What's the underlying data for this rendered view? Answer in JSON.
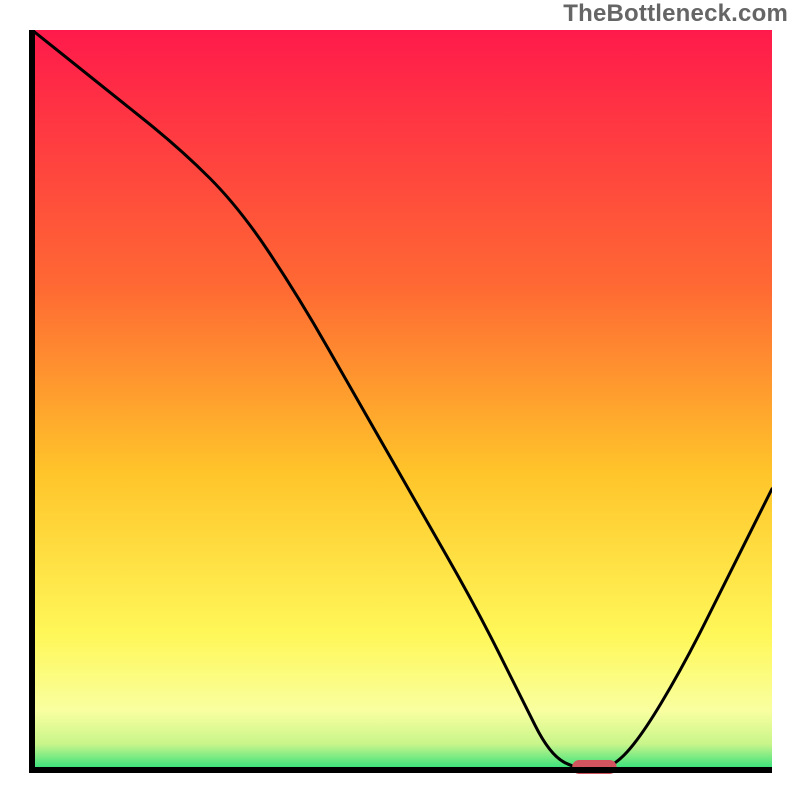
{
  "watermark": {
    "text": "TheBottleneck.com"
  },
  "colors": {
    "frame": "#000000",
    "curve": "#000000",
    "marker_fill": "#d2545f",
    "gradient_stops": [
      {
        "offset": 0.0,
        "color": "#ff1a4b"
      },
      {
        "offset": 0.35,
        "color": "#ff6a33"
      },
      {
        "offset": 0.6,
        "color": "#ffc52a"
      },
      {
        "offset": 0.82,
        "color": "#fff85a"
      },
      {
        "offset": 0.92,
        "color": "#f9ffa0"
      },
      {
        "offset": 0.965,
        "color": "#c8f58b"
      },
      {
        "offset": 1.0,
        "color": "#2de07a"
      }
    ]
  },
  "chart_data": {
    "type": "line",
    "title": "",
    "xlabel": "",
    "ylabel": "",
    "xlim": [
      0,
      100
    ],
    "ylim": [
      0,
      100
    ],
    "series": [
      {
        "name": "bottleneck-curve",
        "x": [
          0,
          10,
          20,
          28,
          36,
          44,
          52,
          60,
          66,
          70,
          74,
          78,
          82,
          88,
          94,
          100
        ],
        "y": [
          100,
          92,
          84,
          76,
          64,
          50,
          36,
          22,
          10,
          2,
          0,
          0,
          4,
          14,
          26,
          38
        ]
      }
    ],
    "marker": {
      "x": 76,
      "y": 0,
      "width": 6,
      "height": 2
    }
  }
}
